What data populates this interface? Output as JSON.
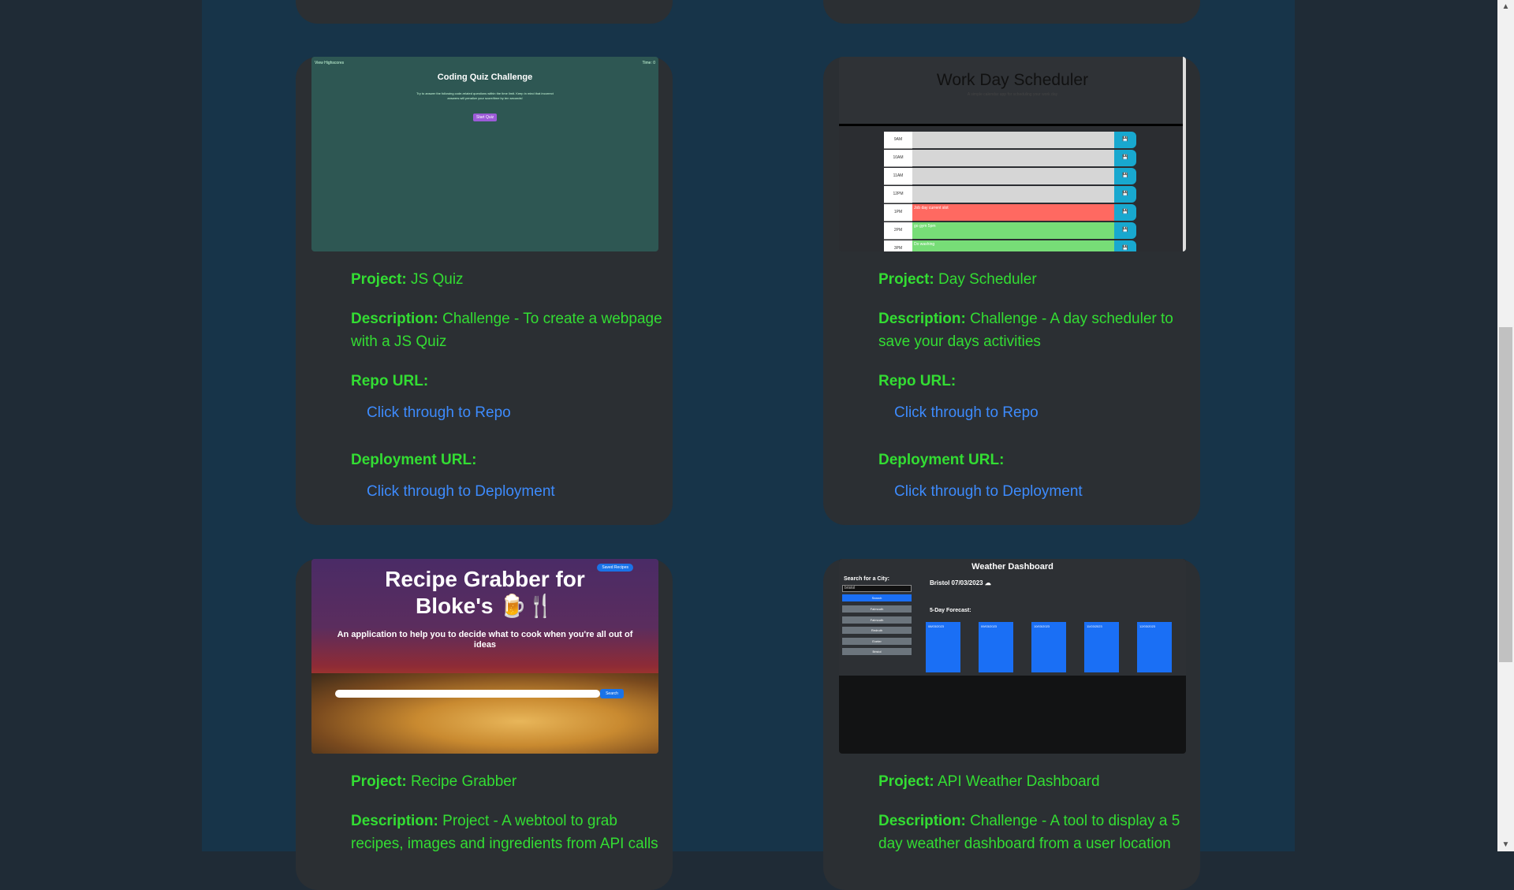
{
  "projects": [
    {
      "name": "JS Quiz",
      "description": "Challenge - To create a webpage with a JS Quiz",
      "repo_link": "Click through to Repo",
      "deploy_link": "Click through to Deployment"
    },
    {
      "name": "Day Scheduler",
      "description": "Challenge - A day scheduler to save your days activities",
      "repo_link": "Click through to Repo",
      "deploy_link": "Click through to Deployment"
    },
    {
      "name": "Recipe Grabber",
      "description": "Project - A webtool to grab recipes, images and ingredients from API calls"
    },
    {
      "name": "API Weather Dashboard",
      "description": "Challenge - A tool to display a 5 day weather dashboard from a user location"
    }
  ],
  "labels": {
    "project": "Project:",
    "description": "Description:",
    "repo_url": "Repo URL:",
    "deploy_url": "Deployment URL:"
  },
  "previews": {
    "quiz": {
      "highscores": "View Highscores",
      "timer": "Time: 0",
      "title": "Coding Quiz Challenge",
      "text": "Try to answer the following code-related questions within the time limit. Keep in mind that incorrect answers will penalize your score/time by ten seconds!",
      "button": "Start Quiz"
    },
    "scheduler": {
      "title": "Work Day Scheduler",
      "subtitle": "A simple calendar app for scheduling your work day",
      "hours": [
        "9AM",
        "10AM",
        "11AM",
        "12PM",
        "1PM",
        "2PM",
        "3PM"
      ],
      "entries": [
        "",
        "",
        "",
        "",
        "Job day current slot",
        "go gym 5pm",
        "Do washing"
      ],
      "colors": [
        "#d6d6d6",
        "#d6d6d6",
        "#d6d6d6",
        "#d6d6d6",
        "#ff6961",
        "#77dd77",
        "#77dd77"
      ]
    },
    "recipe": {
      "title": "Recipe Grabber for Bloke's 🍺🍴",
      "description": "An application to help you to decide what to cook when you're all out of ideas",
      "saved": "Saved Recipes",
      "search_button": "Search"
    },
    "weather": {
      "title": "Weather Dashboard",
      "search_label": "Search for a City:",
      "search_value": "bristol",
      "search_button": "Search",
      "history": [
        "Falmouth",
        "Falmouth",
        "Redruth",
        "Exeter",
        "Bristol"
      ],
      "city": "Bristol 07/03/2023 ☁",
      "forecast_label": "5-Day Forecast:",
      "days": [
        "08/03/2023",
        "09/03/2023",
        "10/03/2023",
        "11/03/2023",
        "12/03/2023"
      ]
    }
  },
  "colors": {
    "page_bg": "#173449",
    "card_bg": "#2b2f33",
    "text_green": "#33dd33",
    "link_blue": "#3d8bfd"
  }
}
